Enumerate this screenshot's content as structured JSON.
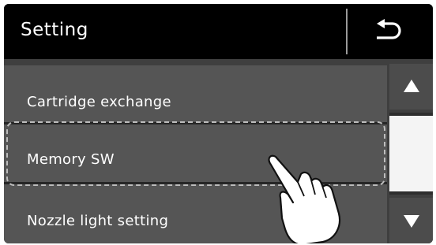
{
  "header": {
    "title": "Setting",
    "back_icon": "back-arrow-icon"
  },
  "menu": {
    "items": [
      {
        "label": "Cartridge exchange"
      },
      {
        "label": "Memory SW",
        "selected": true
      },
      {
        "label": "Nozzle light setting"
      }
    ]
  },
  "scrollbar": {
    "up_icon": "triangle-up-icon",
    "down_icon": "triangle-down-icon"
  },
  "colors": {
    "header_bg": "#000000",
    "item_bg": "#555555",
    "text": "#ffffff"
  }
}
